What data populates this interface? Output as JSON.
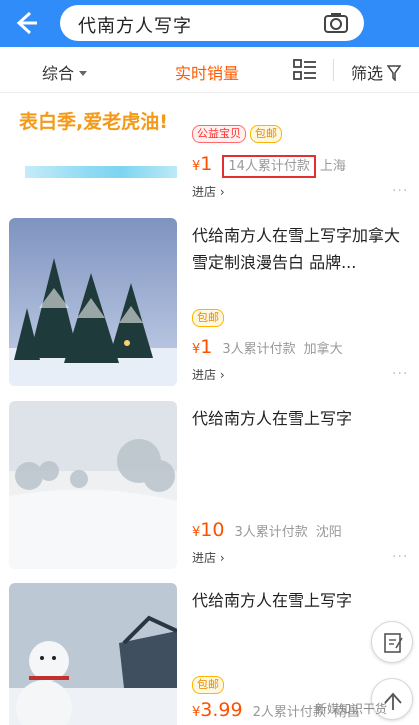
{
  "search": {
    "query": "代南方人写字"
  },
  "sort": {
    "composite": "综合",
    "realtime_sales": "实时销量",
    "filter": "筛选"
  },
  "items": [
    {
      "banner_text": "表白季,爱老虎油!",
      "badges": [
        "公益宝贝",
        "包邮"
      ],
      "price_symbol": "¥",
      "price": "1",
      "paid": "14人累计付款",
      "location": "上海",
      "store": "进店 ›"
    },
    {
      "title": "代给南方人在雪上写字加拿大雪定制浪漫告白  品牌...",
      "badges": [
        "包邮"
      ],
      "price_symbol": "¥",
      "price": "1",
      "paid": "3人累计付款",
      "location": "加拿大",
      "store": "进店 ›"
    },
    {
      "title": "代给南方人在雪上写字",
      "price_symbol": "¥",
      "price": "10",
      "paid": "3人累计付款",
      "location": "沈阳",
      "store": "进店 ›"
    },
    {
      "title": "代给南方人在雪上写字",
      "badges": [
        "包邮"
      ],
      "price_symbol": "¥",
      "price": "3.99",
      "paid": "2人累计付款",
      "location": "南昌"
    }
  ],
  "more_label": "···",
  "watermark": "新媒知识干货",
  "icons": [
    "back-arrow-icon",
    "camera-icon",
    "grid-toggle-icon",
    "filter-icon",
    "edit-icon",
    "to-top-icon"
  ],
  "colors": {
    "brand_blue": "#2f8cf8",
    "price_orange": "#ff5000",
    "highlight_red": "#e03030"
  }
}
